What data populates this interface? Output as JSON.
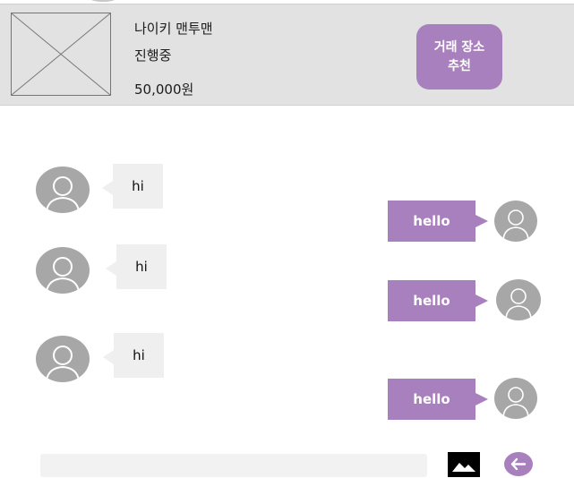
{
  "product": {
    "title": "나이키 맨투맨",
    "status": "진행중",
    "price": "50,000원",
    "thumbnail_icon": "image-placeholder-icon"
  },
  "recommend_button": {
    "label": "거래 장소\n추천"
  },
  "messages": [
    {
      "side": "received",
      "text": "hi"
    },
    {
      "side": "sent",
      "text": "hello"
    },
    {
      "side": "received",
      "text": "hi"
    },
    {
      "side": "sent",
      "text": "hello"
    },
    {
      "side": "received",
      "text": "hi"
    },
    {
      "side": "sent",
      "text": "hello"
    }
  ],
  "input": {
    "placeholder": ""
  },
  "icons": {
    "attach": "image-icon",
    "send": "arrow-left-icon",
    "avatar": "user-icon"
  },
  "colors": {
    "accent": "#a880bd",
    "header_bg": "#e2e2e2",
    "bubble_in": "#efefef",
    "avatar": "#a7a7a7"
  }
}
